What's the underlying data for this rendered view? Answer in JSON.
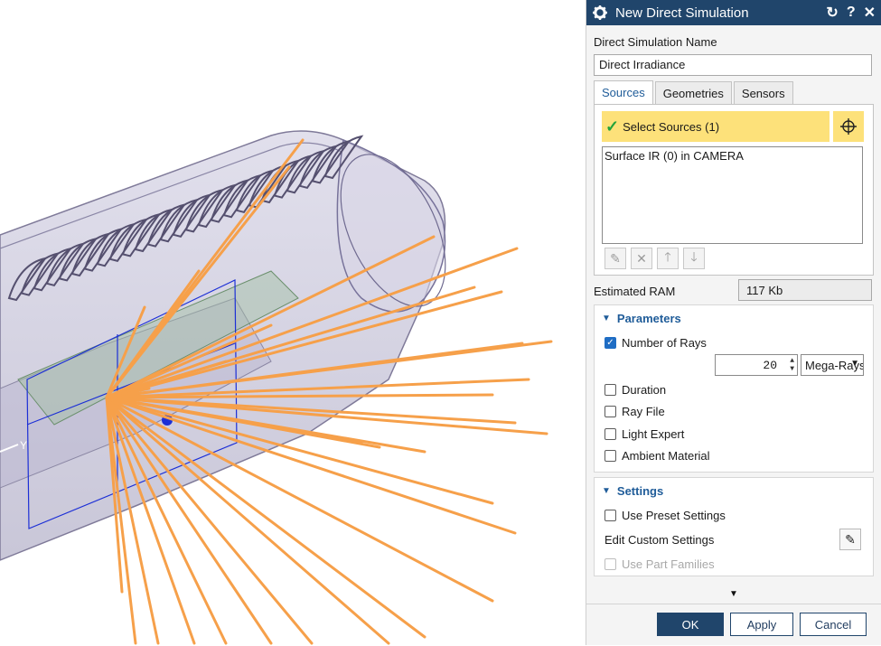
{
  "viewport": {
    "axis_label": "Y"
  },
  "dialog": {
    "title": "New Direct Simulation",
    "title_buttons": {
      "reset": "↻",
      "help": "?",
      "close": "✕"
    },
    "name_label": "Direct Simulation Name",
    "name_value": "Direct Irradiance",
    "tabs": [
      {
        "label": "Sources",
        "active": true
      },
      {
        "label": "Geometries",
        "active": false
      },
      {
        "label": "Sensors",
        "active": false
      }
    ],
    "select_sources_label": "Select Sources (1)",
    "source_list": [
      "Surface IR (0) in CAMERA"
    ],
    "estimated_ram_label": "Estimated RAM",
    "estimated_ram_value": "117 Kb",
    "parameters": {
      "header": "Parameters",
      "number_of_rays": {
        "label": "Number of Rays",
        "checked": true,
        "value": "20",
        "unit": "Mega-Rays"
      },
      "duration": {
        "label": "Duration",
        "checked": false
      },
      "ray_file": {
        "label": "Ray File",
        "checked": false
      },
      "light_expert": {
        "label": "Light Expert",
        "checked": false
      },
      "ambient_material": {
        "label": "Ambient Material",
        "checked": false
      }
    },
    "settings": {
      "header": "Settings",
      "use_preset": {
        "label": "Use Preset Settings",
        "checked": false
      },
      "edit_custom_label": "Edit Custom Settings",
      "use_part_families": {
        "label": "Use Part Families",
        "checked": false,
        "disabled": true
      }
    },
    "buttons": {
      "ok": "OK",
      "apply": "Apply",
      "cancel": "Cancel"
    }
  }
}
